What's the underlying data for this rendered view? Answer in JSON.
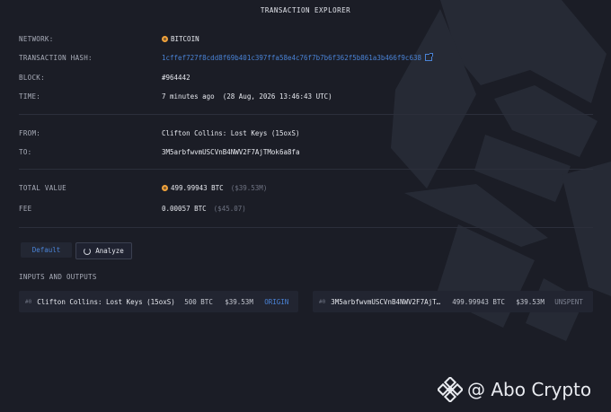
{
  "header": {
    "title": "TRANSACTION EXPLORER"
  },
  "details": {
    "network_label": "NETWORK:",
    "network_value": "BITCOIN",
    "hash_label": "TRANSACTION HASH:",
    "hash_value": "1cffef727f8cdd8f69b401c397ffa58e4c76f7b7b6f362f5b861a3b466f9c638",
    "block_label": "BLOCK:",
    "block_value": "#964442",
    "time_label": "TIME:",
    "time_value": "7 minutes ago  (28 Aug, 2026 13:46:43 UTC)",
    "from_label": "FROM:",
    "from_value": "Clifton Collins: Lost Keys (15oxS)",
    "to_label": "TO:",
    "to_value": "3M5arbfwvmUSCVnB4NWV2F7AjTMok6a8fa",
    "total_label": "TOTAL VALUE",
    "total_value": "499.99943 BTC",
    "total_usd": "($39.53M)",
    "fee_label": "FEE",
    "fee_value": "0.00057 BTC",
    "fee_usd": "($45.07)"
  },
  "buttons": {
    "default_label": "Default",
    "analyze_label": "Analyze"
  },
  "io": {
    "section_label": "INPUTS AND OUTPUTS",
    "input": {
      "index": "#0",
      "name": "Clifton Collins: Lost Keys (15oxS)",
      "btc": "500 BTC",
      "usd": "$39.53M",
      "tag": "ORIGIN"
    },
    "output": {
      "index": "#0",
      "name": "3M5arbfwvmUSCVnB4NWV2F7AjT…",
      "btc": "499.99943 BTC",
      "usd": "$39.53M",
      "tag": "UNSPENT"
    }
  },
  "watermark": {
    "text": "@ Abo Crypto"
  },
  "colors": {
    "background": "#1b1d26",
    "link": "#4a83d6",
    "bitcoin": "#f0a23b"
  },
  "icons": [
    "bitcoin-icon",
    "external-link-icon",
    "spinner-icon",
    "binance-logo-icon",
    "arkham-logo-icon"
  ]
}
